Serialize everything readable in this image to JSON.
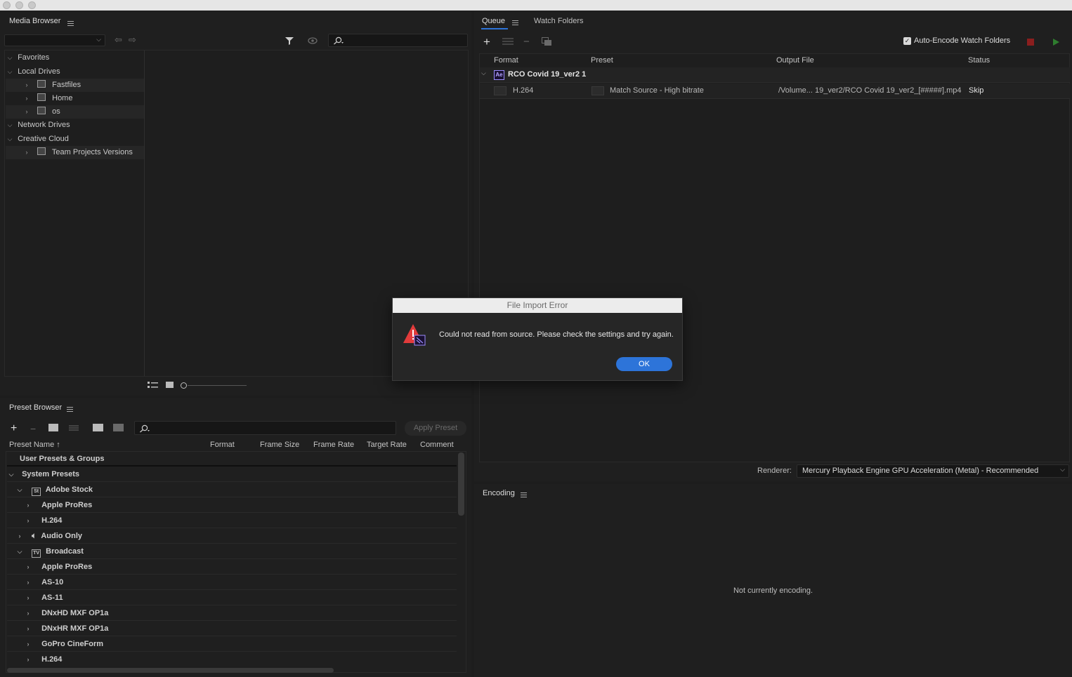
{
  "media_browser": {
    "title": "Media Browser",
    "tree": [
      {
        "label": "Favorites"
      },
      {
        "label": "Local Drives"
      },
      {
        "label": "Fastfiles"
      },
      {
        "label": "Home"
      },
      {
        "label": "os"
      },
      {
        "label": "Network Drives"
      },
      {
        "label": "Creative Cloud"
      },
      {
        "label": "Team Projects Versions"
      }
    ]
  },
  "queue": {
    "tabs": [
      {
        "label": "Queue"
      },
      {
        "label": "Watch Folders"
      }
    ],
    "auto_encode_label": "Auto-Encode Watch Folders",
    "columns": {
      "format": "Format",
      "preset": "Preset",
      "output": "Output File",
      "status": "Status"
    },
    "source": {
      "badge": "Ae",
      "name": "RCO Covid 19_ver2 1"
    },
    "item": {
      "format": "H.264",
      "preset": "Match Source - High bitrate",
      "output": "/Volume... 19_ver2/RCO Covid 19_ver2_[#####].mp4",
      "status": "Skip"
    },
    "renderer_label": "Renderer:",
    "renderer_value": "Mercury Playback Engine GPU Acceleration (Metal) - Recommended"
  },
  "preset_browser": {
    "title": "Preset Browser",
    "apply_label": "Apply Preset",
    "columns": {
      "name": "Preset Name",
      "format": "Format",
      "frame_size": "Frame Size",
      "frame_rate": "Frame Rate",
      "target_rate": "Target Rate",
      "comment": "Comment"
    },
    "rows": [
      {
        "label": "User Presets & Groups"
      },
      {
        "label": "System Presets"
      },
      {
        "label": "Adobe Stock",
        "badge": "St"
      },
      {
        "label": "Apple ProRes"
      },
      {
        "label": "H.264"
      },
      {
        "label": "Audio Only"
      },
      {
        "label": "Broadcast",
        "badge": "TV"
      },
      {
        "label": "Apple ProRes"
      },
      {
        "label": "AS-10"
      },
      {
        "label": "AS-11"
      },
      {
        "label": "DNxHD MXF OP1a"
      },
      {
        "label": "DNxHR MXF OP1a"
      },
      {
        "label": "GoPro CineForm"
      },
      {
        "label": "H.264"
      }
    ]
  },
  "encoding": {
    "title": "Encoding",
    "status": "Not currently encoding."
  },
  "dialog": {
    "title": "File Import Error",
    "message": "Could not read from source. Please check the settings and try again.",
    "ok_label": "OK"
  },
  "colors": {
    "accent": "#2d74d9",
    "stop": "#8b1e1e",
    "play": "#2f7d2f",
    "warning": "#e23b3b"
  }
}
